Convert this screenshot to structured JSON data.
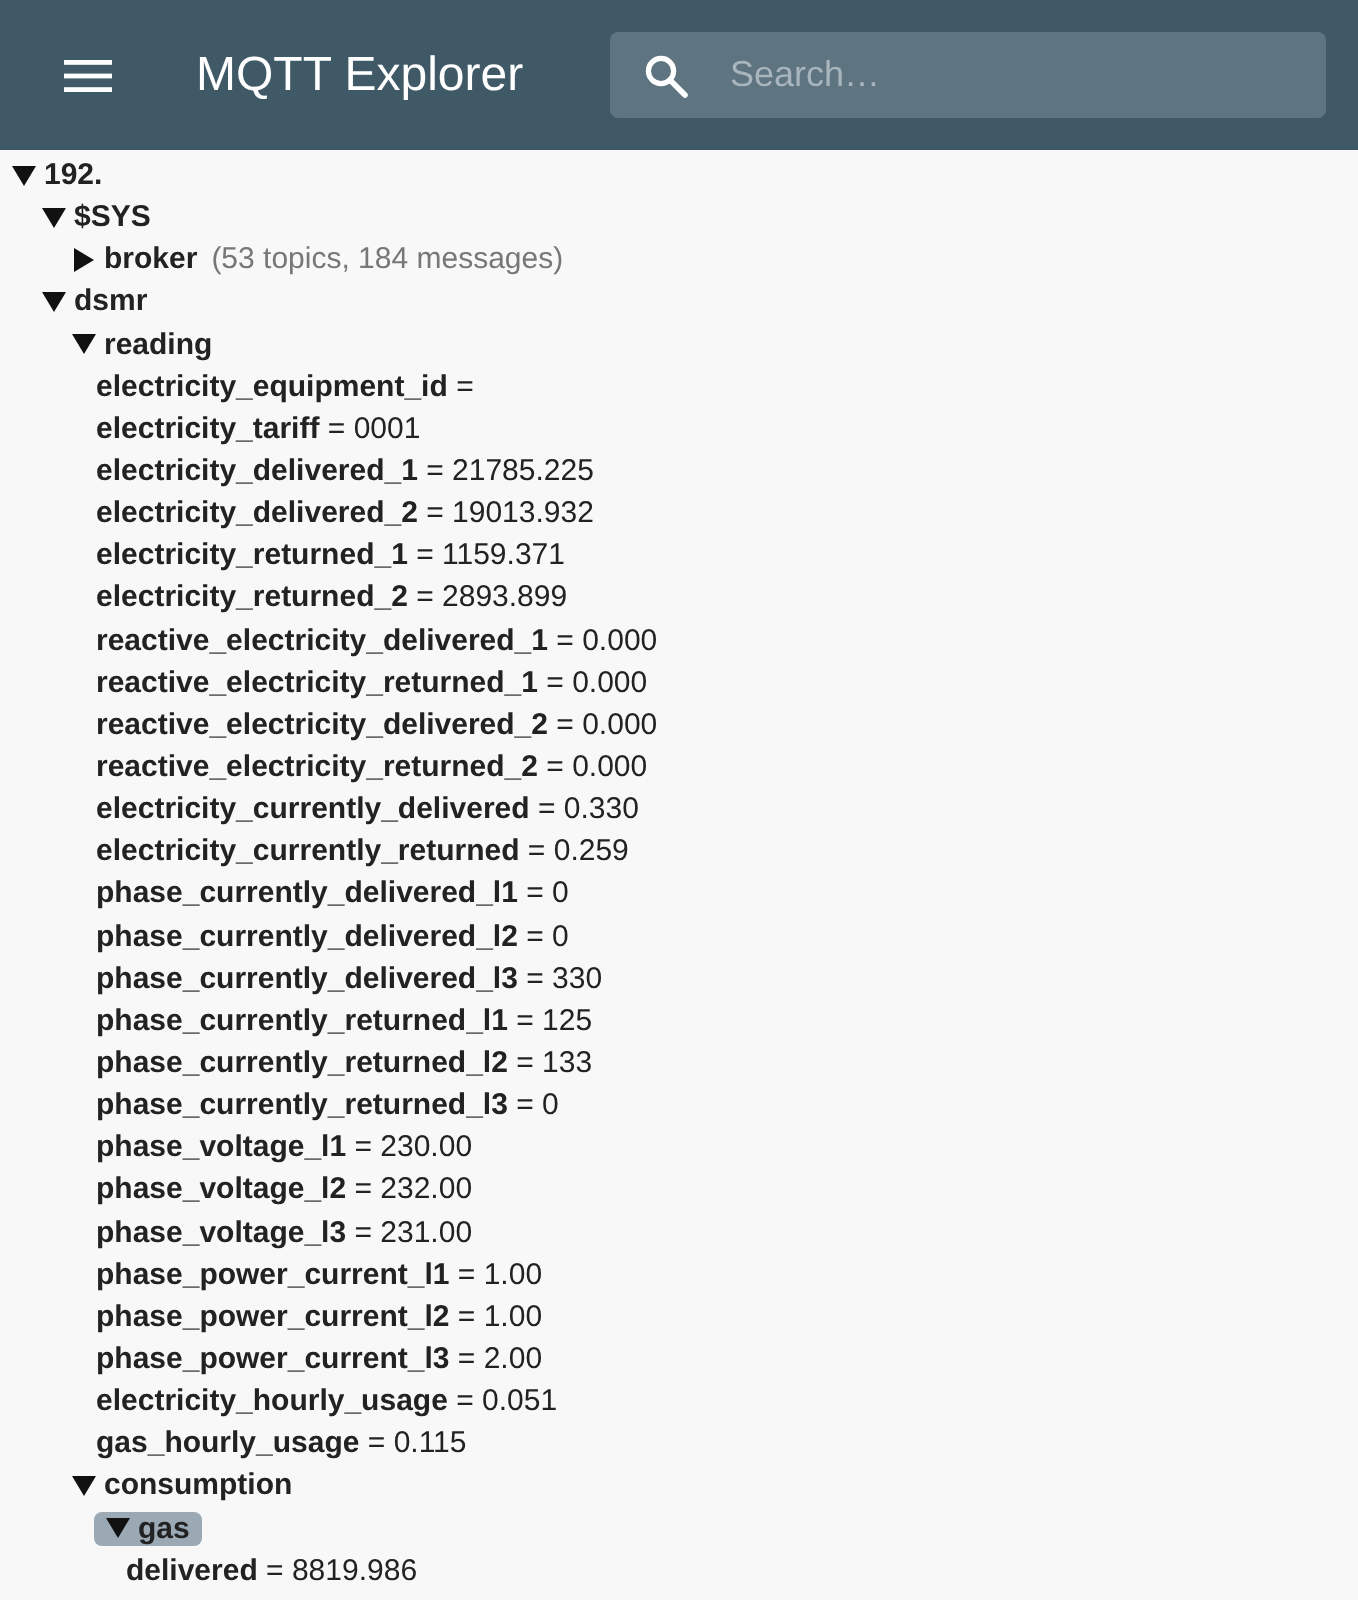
{
  "app_bar": {
    "title": "MQTT Explorer",
    "search": {
      "placeholder": "Search…"
    }
  },
  "tree": [
    {
      "name": "192.",
      "expanded": true,
      "selected": false,
      "children": [
        {
          "name": "$SYS",
          "expanded": true,
          "selected": false,
          "children": [
            {
              "name": "broker",
              "expanded": false,
              "selected": false,
              "summary": "(53 topics, 184 messages)"
            }
          ]
        },
        {
          "name": "dsmr",
          "expanded": true,
          "selected": false,
          "children": [
            {
              "name": "reading",
              "expanded": true,
              "selected": false,
              "children": [
                {
                  "name": "electricity_equipment_id",
                  "value": "="
                },
                {
                  "name": "electricity_tariff",
                  "value": "= 0001"
                },
                {
                  "name": "electricity_delivered_1",
                  "value": "= 21785.225"
                },
                {
                  "name": "electricity_delivered_2",
                  "value": "= 19013.932"
                },
                {
                  "name": "electricity_returned_1",
                  "value": "= 1159.371"
                },
                {
                  "name": "electricity_returned_2",
                  "value": "= 2893.899"
                },
                {
                  "name": "reactive_electricity_delivered_1",
                  "value": "= 0.000"
                },
                {
                  "name": "reactive_electricity_returned_1",
                  "value": "= 0.000"
                },
                {
                  "name": "reactive_electricity_delivered_2",
                  "value": "= 0.000"
                },
                {
                  "name": "reactive_electricity_returned_2",
                  "value": "= 0.000"
                },
                {
                  "name": "electricity_currently_delivered",
                  "value": "= 0.330"
                },
                {
                  "name": "electricity_currently_returned",
                  "value": "= 0.259"
                },
                {
                  "name": "phase_currently_delivered_l1",
                  "value": "= 0"
                },
                {
                  "name": "phase_currently_delivered_l2",
                  "value": "= 0"
                },
                {
                  "name": "phase_currently_delivered_l3",
                  "value": "= 330"
                },
                {
                  "name": "phase_currently_returned_l1",
                  "value": "= 125"
                },
                {
                  "name": "phase_currently_returned_l2",
                  "value": "= 133"
                },
                {
                  "name": "phase_currently_returned_l3",
                  "value": "= 0"
                },
                {
                  "name": "phase_voltage_l1",
                  "value": "= 230.00"
                },
                {
                  "name": "phase_voltage_l2",
                  "value": "= 232.00"
                },
                {
                  "name": "phase_voltage_l3",
                  "value": "= 231.00"
                },
                {
                  "name": "phase_power_current_l1",
                  "value": "= 1.00"
                },
                {
                  "name": "phase_power_current_l2",
                  "value": "= 1.00"
                },
                {
                  "name": "phase_power_current_l3",
                  "value": "= 2.00"
                },
                {
                  "name": "electricity_hourly_usage",
                  "value": "= 0.051"
                },
                {
                  "name": "gas_hourly_usage",
                  "value": "= 0.115"
                }
              ]
            },
            {
              "name": "consumption",
              "expanded": true,
              "selected": false,
              "children": [
                {
                  "name": "gas",
                  "expanded": true,
                  "selected": true,
                  "children": [
                    {
                      "name": "delivered",
                      "value": "= 8819.986"
                    }
                  ]
                }
              ]
            }
          ]
        }
      ]
    }
  ]
}
